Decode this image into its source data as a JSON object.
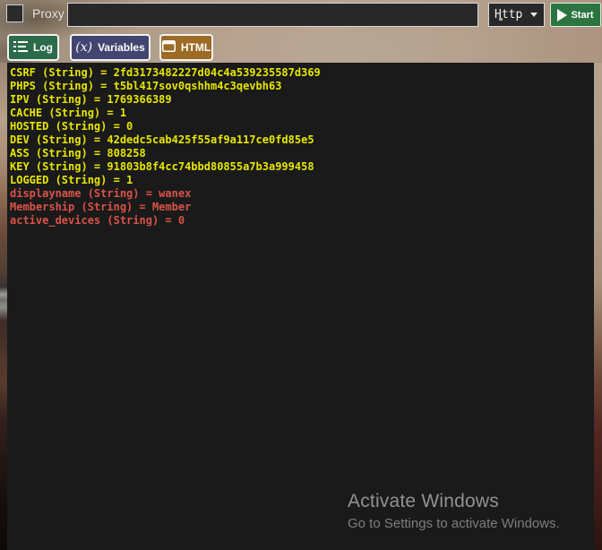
{
  "colors": {
    "console-bg": "#1a1a1a",
    "console-yellow": "#e6e600",
    "console-red": "#da5347",
    "log-green": "#2c6b4a",
    "variables-purple": "#414570",
    "html-brown": "#9d6b26",
    "start-green": "#2c7540",
    "input-dark": "#282828"
  },
  "toolbar": {
    "proxy_label": "Proxy",
    "url_input": {
      "value": ""
    },
    "method_dropdown": {
      "value": "Http"
    },
    "start_button": {
      "label": "Start"
    }
  },
  "tabs": {
    "log": {
      "label": "Log"
    },
    "variables": {
      "label": "Variables",
      "icon_text": "(x)"
    },
    "html": {
      "label": "HTML"
    }
  },
  "console": {
    "lines": [
      {
        "tone": "yellow",
        "text": "CSRF (String) = 2fd3173482227d04c4a539235587d369"
      },
      {
        "tone": "yellow",
        "text": "PHPS (String) = t5bl417sov0qshhm4c3qevbh63"
      },
      {
        "tone": "yellow",
        "text": "IPV (String) = 1769366389"
      },
      {
        "tone": "yellow",
        "text": "CACHE (String) = 1"
      },
      {
        "tone": "yellow",
        "text": "HOSTED (String) = 0"
      },
      {
        "tone": "yellow",
        "text": "DEV (String) = 42dedc5cab425f55af9a117ce0fd85e5"
      },
      {
        "tone": "yellow",
        "text": "ASS (String) = 808258"
      },
      {
        "tone": "yellow",
        "text": "KEY (String) = 91803b8f4cc74bbd80855a7b3a999458"
      },
      {
        "tone": "yellow",
        "text": "LOGGED (String) = 1"
      },
      {
        "tone": "red",
        "text": "displayname (String) = wanex"
      },
      {
        "tone": "red",
        "text": "Membership (String) = Member"
      },
      {
        "tone": "red",
        "text": "active_devices (String) = 0"
      }
    ]
  },
  "watermark": {
    "title": "Activate Windows",
    "subtitle": "Go to Settings to activate Windows."
  }
}
